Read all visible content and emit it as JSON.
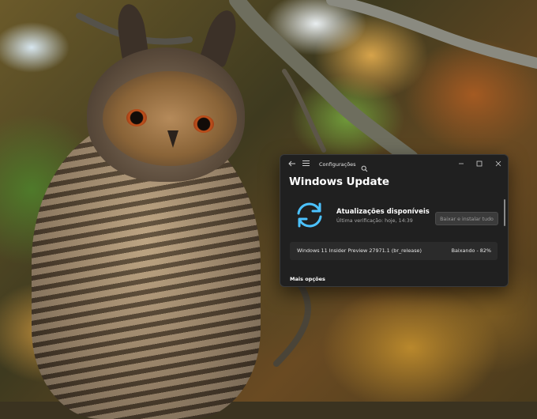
{
  "window": {
    "app_title": "Configurações",
    "page_title": "Windows Update",
    "back_icon": "back-arrow-icon",
    "menu_icon": "hamburger-menu-icon",
    "search_icon": "search-icon",
    "min_icon": "minimize-icon",
    "max_icon": "maximize-icon",
    "close_icon": "close-icon"
  },
  "status": {
    "icon": "sync-arrows-icon",
    "title": "Atualizações disponíveis",
    "last_check": "Última verificação: hoje, 14:39",
    "action_label": "Baixar e instalar tudo"
  },
  "updates": [
    {
      "name": "Windows 11 Insider Preview 27971.1 (br_release)",
      "status": "Baixando - 82%"
    }
  ],
  "more_options": "Mais opções",
  "colors": {
    "accent": "#4cc2ff",
    "window_bg": "#202020",
    "card_bg": "#2b2b2b"
  }
}
